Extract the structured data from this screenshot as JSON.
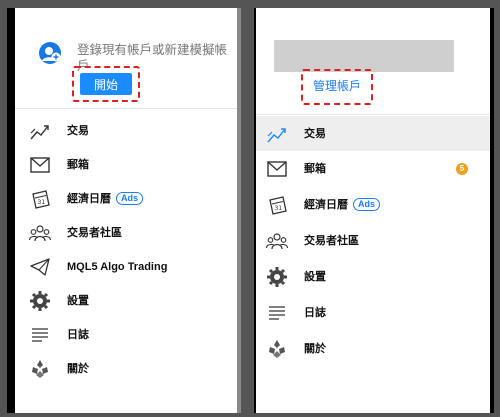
{
  "left": {
    "login_prompt": "登錄現有帳戶或新建模擬帳戶",
    "start_label": "開始",
    "menu": [
      {
        "label": "交易",
        "icon": "trade-chart-icon"
      },
      {
        "label": "郵箱",
        "icon": "mail-icon"
      },
      {
        "label": "經濟日曆",
        "icon": "calendar-icon",
        "badge": "Ads"
      },
      {
        "label": "交易者社區",
        "icon": "community-icon"
      },
      {
        "label": "MQL5 Algo Trading",
        "icon": "telegram-icon"
      },
      {
        "label": "設置",
        "icon": "gear-icon"
      },
      {
        "label": "日誌",
        "icon": "journal-icon"
      },
      {
        "label": "關於",
        "icon": "about-logo-icon"
      }
    ]
  },
  "right": {
    "manage_accounts_label": "管理帳戶",
    "menu": [
      {
        "label": "交易",
        "icon": "trade-chart-icon",
        "active": true
      },
      {
        "label": "郵箱",
        "icon": "mail-icon",
        "count": "5"
      },
      {
        "label": "經濟日曆",
        "icon": "calendar-icon",
        "badge": "Ads"
      },
      {
        "label": "交易者社區",
        "icon": "community-icon"
      },
      {
        "label": "設置",
        "icon": "gear-icon"
      },
      {
        "label": "日誌",
        "icon": "journal-icon"
      },
      {
        "label": "關於",
        "icon": "about-logo-icon"
      }
    ]
  },
  "colors": {
    "accent": "#1a8cff",
    "highlight_border": "#e02020",
    "badge": "#f0a020",
    "active_row": "#eeeeee"
  }
}
